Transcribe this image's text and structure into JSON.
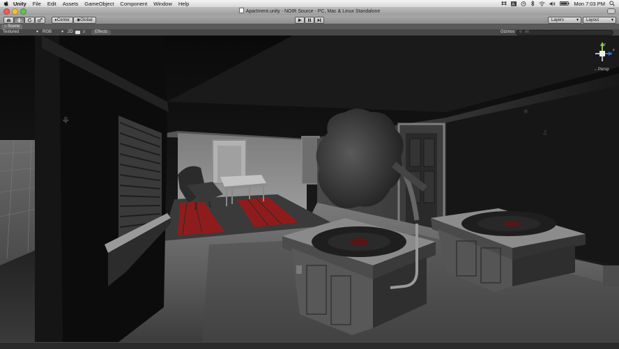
{
  "menubar": {
    "app": "Unity",
    "items": [
      "File",
      "Edit",
      "Assets",
      "GameObject",
      "Component",
      "Window",
      "Help"
    ],
    "clock": "Mon 7:03 PM"
  },
  "window": {
    "title": "Apartment.unity - NOIR Source - PC, Mac & Linux Standalone"
  },
  "toolbar": {
    "pivot_center": "Center",
    "pivot_global": "Global",
    "layers_label": "Layers",
    "layout_label": "Layout"
  },
  "scene": {
    "tab_label": "Scene",
    "render_mode": "Textured",
    "color_mode": "RGB",
    "toggle_2d": "2D",
    "effects_label": "Effects",
    "gizmos_label": "Gizmos",
    "search_placeholder": "All",
    "persp_label": "Persp",
    "gizmo_axis_y": "y",
    "gizmo_axis_z": "z"
  }
}
